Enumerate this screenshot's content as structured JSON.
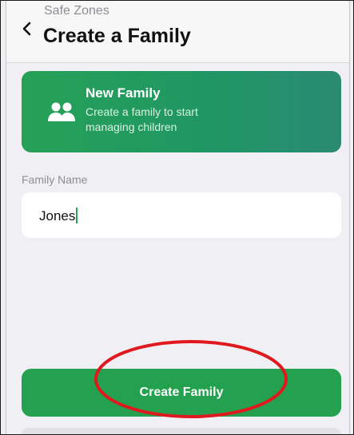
{
  "header": {
    "breadcrumb": "Safe Zones",
    "title": "Create a Family",
    "back_icon": "chevron-left-icon"
  },
  "banner": {
    "icon": "family-icon",
    "title": "New Family",
    "subtitle": "Create a family to start managing children",
    "gradient_colors": [
      "#26a157",
      "#2a8a73"
    ]
  },
  "form": {
    "family_name_label": "Family Name",
    "family_name_value": "Jones"
  },
  "actions": {
    "create_label": "Create Family",
    "button_color": "#23a14e"
  },
  "annotation": {
    "highlight_color": "#e0191e"
  }
}
